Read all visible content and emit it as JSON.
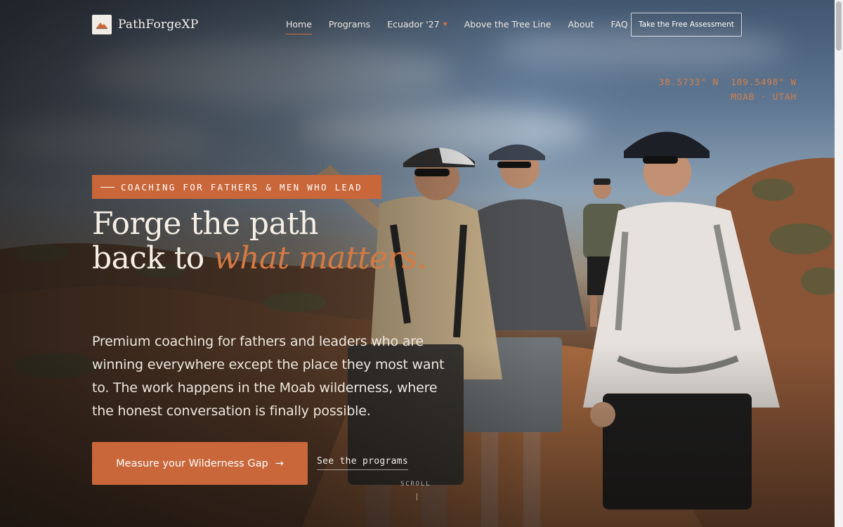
{
  "brand": {
    "name": "PathForgeXP",
    "logo_icon": "mountain-logo-icon"
  },
  "nav": {
    "links": [
      {
        "label": "Home",
        "active": true
      },
      {
        "label": "Programs"
      },
      {
        "label": "Ecuador '27",
        "has_dropdown": true
      },
      {
        "label": "Above the Tree Line"
      },
      {
        "label": "About"
      },
      {
        "label": "FAQ"
      }
    ],
    "cta_label": "Take the Free Assessment"
  },
  "coordinates": {
    "line1": "38.5733° N  109.5498° W",
    "line2": "MOAB · UTAH"
  },
  "hero": {
    "eyebrow": "COACHING FOR FATHERS & MEN WHO LEAD",
    "headline_part1": "Forge the path",
    "headline_part2": "back to ",
    "headline_accent": "what matters.",
    "lede": "Premium coaching for fathers and leaders who are winning everywhere except the place they most want to. The work happens in the Moab wilderness, where the honest conversation is finally possible.",
    "primary_cta": "Measure your Wilderness Gap",
    "primary_cta_icon": "arrow-right-icon",
    "secondary_cta": "See the programs",
    "scroll_label": "SCROLL"
  },
  "colors": {
    "accent": "#c9673a",
    "accent_text": "#d57a44",
    "text": "#f5efe6"
  }
}
